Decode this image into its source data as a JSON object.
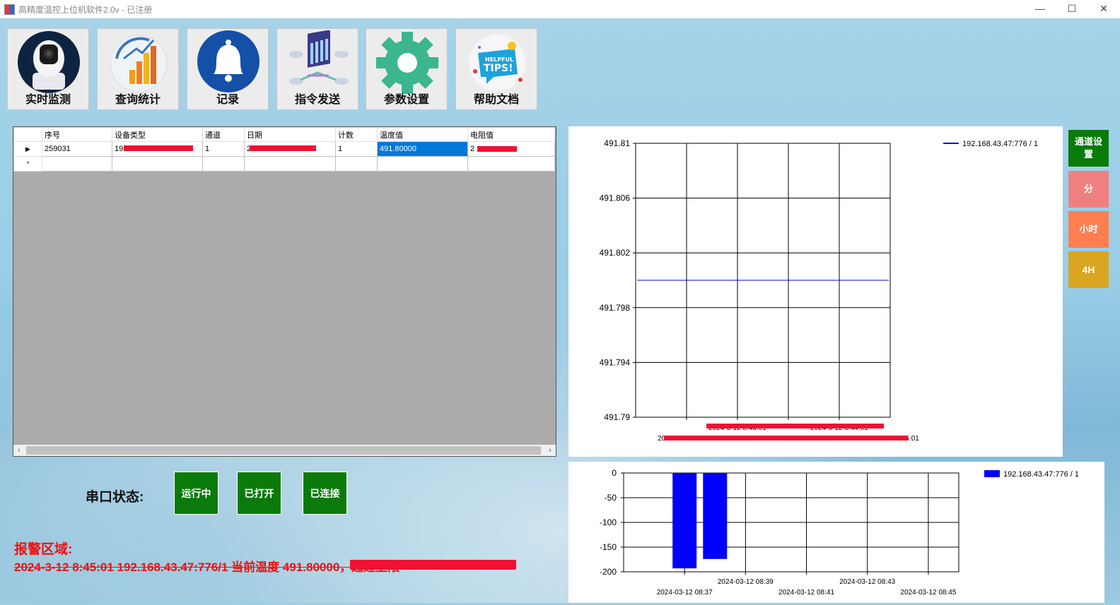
{
  "window": {
    "title": "高精度温控上位机软件2.0v - 已注册",
    "minimize": "—",
    "maximize": "☐",
    "close": "✕"
  },
  "toolbar": [
    {
      "label": "实时监测",
      "icon": "camera-icon"
    },
    {
      "label": "查询统计",
      "icon": "bar-growth-icon"
    },
    {
      "label": "记录",
      "icon": "bell-icon"
    },
    {
      "label": "指令发送",
      "icon": "server-network-icon"
    },
    {
      "label": "参数设置",
      "icon": "gear-icon"
    },
    {
      "label": "帮助文档",
      "icon": "helpful-tips-icon"
    }
  ],
  "tips_icon_text": [
    "HELPFUL",
    "TIPS!"
  ],
  "grid": {
    "columns": [
      "序号",
      "设备类型",
      "通道",
      "日期",
      "计数",
      "温度值",
      "电阻值"
    ],
    "rows": [
      [
        "259031",
        "192",
        "1",
        "2",
        "1",
        "491.80000",
        "2"
      ]
    ]
  },
  "side_buttons": [
    {
      "label": "通道设置",
      "color": "#0a7a0a"
    },
    {
      "label": "分",
      "color": "#f08080"
    },
    {
      "label": "小时",
      "color": "#ff7f50"
    },
    {
      "label": "4H",
      "color": "#daa520"
    }
  ],
  "status": {
    "label": "串口状态:",
    "buttons": [
      "运行中",
      "已打开",
      "已连接"
    ]
  },
  "alarm": {
    "title": "报警区域:",
    "line": "2024-3-12 8:45:01 192.168.43.47:776/1 当前温度 491.80000，超过上限"
  },
  "chart_data": [
    {
      "type": "line",
      "series": [
        {
          "name": "192.168.43.47:776 / 1",
          "color": "#0000ff",
          "y": [
            491.8,
            491.8
          ]
        }
      ],
      "ylim": [
        491.79,
        491.81
      ],
      "y_ticks": [
        "491.81",
        "491.806",
        "491.802",
        "491.798",
        "491.794",
        "491.79"
      ],
      "x_ticks_row1": [
        "2024-3-12 8:43:01",
        "2024-3-12 8:44:01"
      ],
      "x_ticks_row2": [
        "2024-3-12 8:41:01",
        "2024-3-12 8:42:01",
        "2024-3-12 8:45:01"
      ],
      "grid": true,
      "legend": "top-right"
    },
    {
      "type": "bar",
      "series": [
        {
          "name": "192.168.43.47:776 / 1",
          "color": "#0000ff",
          "x": [
            "2024-03-12 08:37",
            "2024-03-12 08:38"
          ],
          "values": [
            -193,
            -174
          ]
        }
      ],
      "ylim": [
        -200,
        0
      ],
      "y_ticks": [
        "0",
        "-50",
        "-100",
        "-150",
        "-200"
      ],
      "x_ticks_row1": [
        "2024-03-12 08:39",
        "2024-03-12 08:43"
      ],
      "x_ticks_row2": [
        "2024-03-12 08:37",
        "2024-03-12 08:41",
        "2024-03-12 08:45"
      ],
      "grid": true,
      "legend": "top-right"
    }
  ]
}
